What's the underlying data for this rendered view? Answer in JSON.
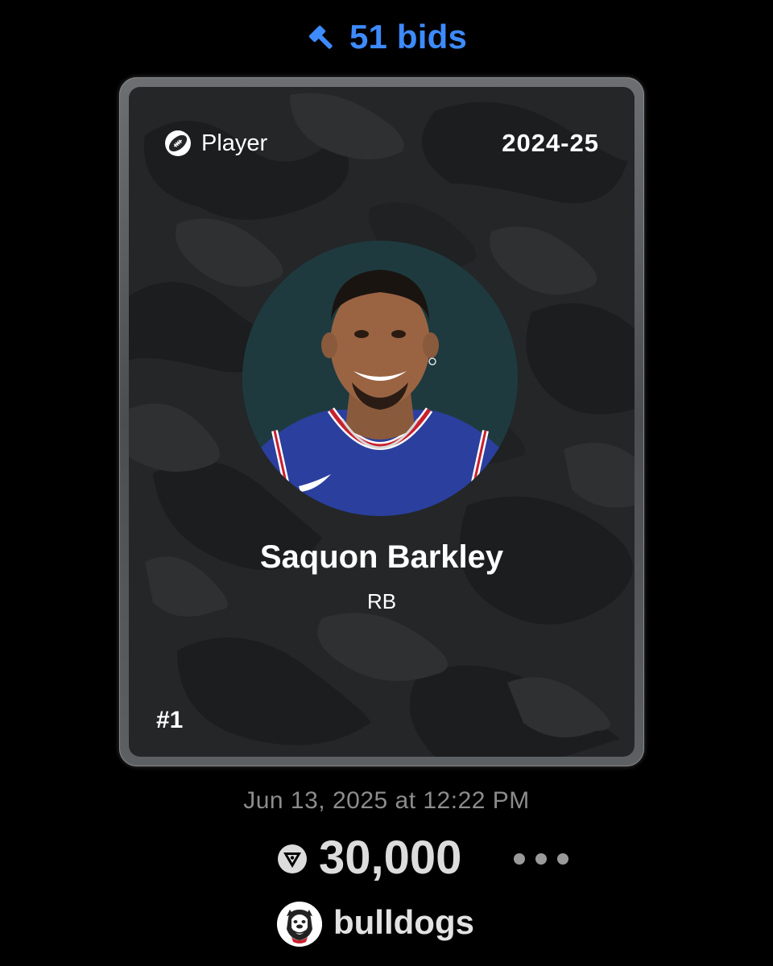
{
  "listing": {
    "bids_label": "51 bids",
    "bids_color": "#3d8bff"
  },
  "card": {
    "type_label": "Player",
    "type_icon": "football-icon",
    "season": "2024-25",
    "player_name": "Saquon Barkley",
    "position": "RB",
    "number": "#1"
  },
  "sale": {
    "timestamp": "Jun 13, 2025 at 12:22 PM",
    "price": "30,000",
    "currency_icon": "cro-coin-icon"
  },
  "owner": {
    "username": "bulldogs",
    "avatar_icon": "bulldog-logo-icon"
  }
}
